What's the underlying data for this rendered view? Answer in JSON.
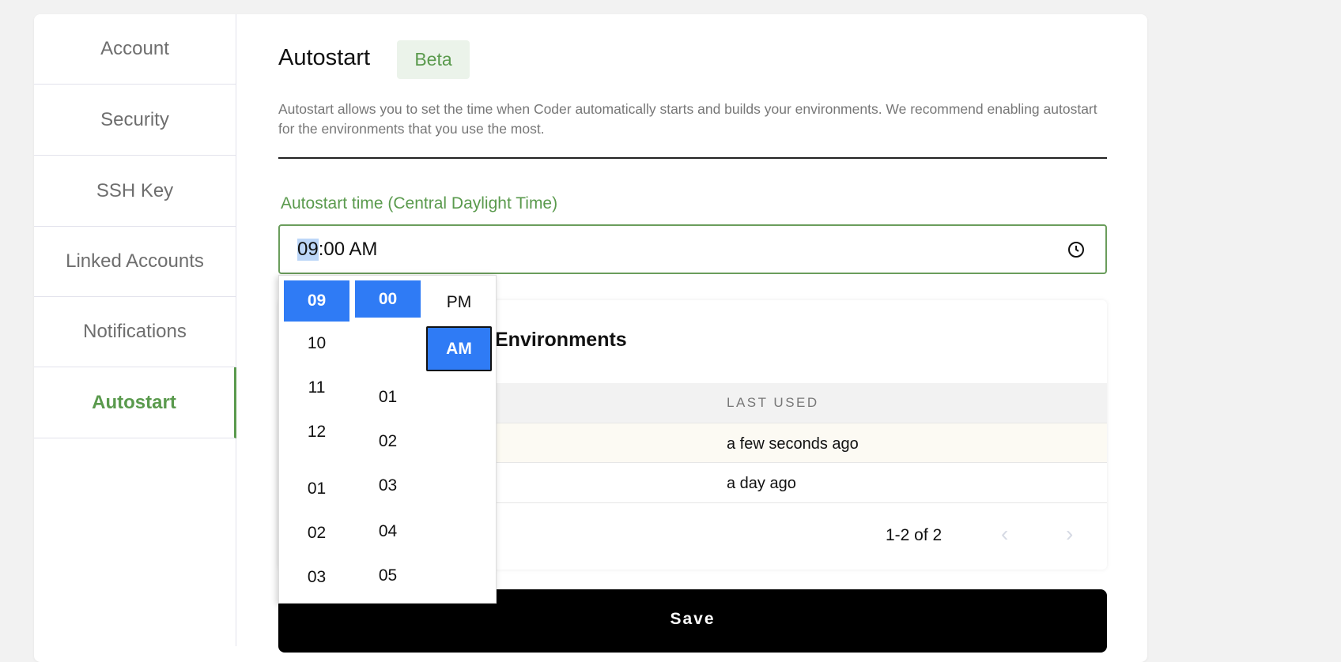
{
  "sidebar": {
    "items": [
      {
        "label": "Account"
      },
      {
        "label": "Security"
      },
      {
        "label": "SSH Key"
      },
      {
        "label": "Linked Accounts"
      },
      {
        "label": "Notifications"
      },
      {
        "label": "Autostart",
        "active": true
      }
    ]
  },
  "header": {
    "title": "Autostart",
    "badge": "Beta"
  },
  "description": "Autostart allows you to set the time when Coder automatically starts and builds your environments. We recommend enabling autostart for the environments that you use the most.",
  "field": {
    "label": "Autostart time (Central Daylight Time)",
    "hour": "09",
    "rest": ":00 AM"
  },
  "picker": {
    "hours": [
      "09",
      "10",
      "11",
      "12",
      "01",
      "02",
      "03"
    ],
    "minutes": [
      "00",
      "01",
      "02",
      "03",
      "04",
      "05"
    ],
    "periods": [
      "PM",
      "AM"
    ],
    "selected": {
      "hour": "09",
      "minute": "00",
      "period": "AM"
    }
  },
  "environments": {
    "heading": "Environments",
    "column": "LAST USED",
    "rows": [
      {
        "last_used": "a few seconds ago"
      },
      {
        "last_used": "a day ago"
      }
    ],
    "pagination": "1-2 of 2",
    "prev_icon": "‹",
    "next_icon": "›"
  },
  "save_label": "Save",
  "colors": {
    "accent": "#5a9a4d",
    "select": "#2f7bf5"
  }
}
